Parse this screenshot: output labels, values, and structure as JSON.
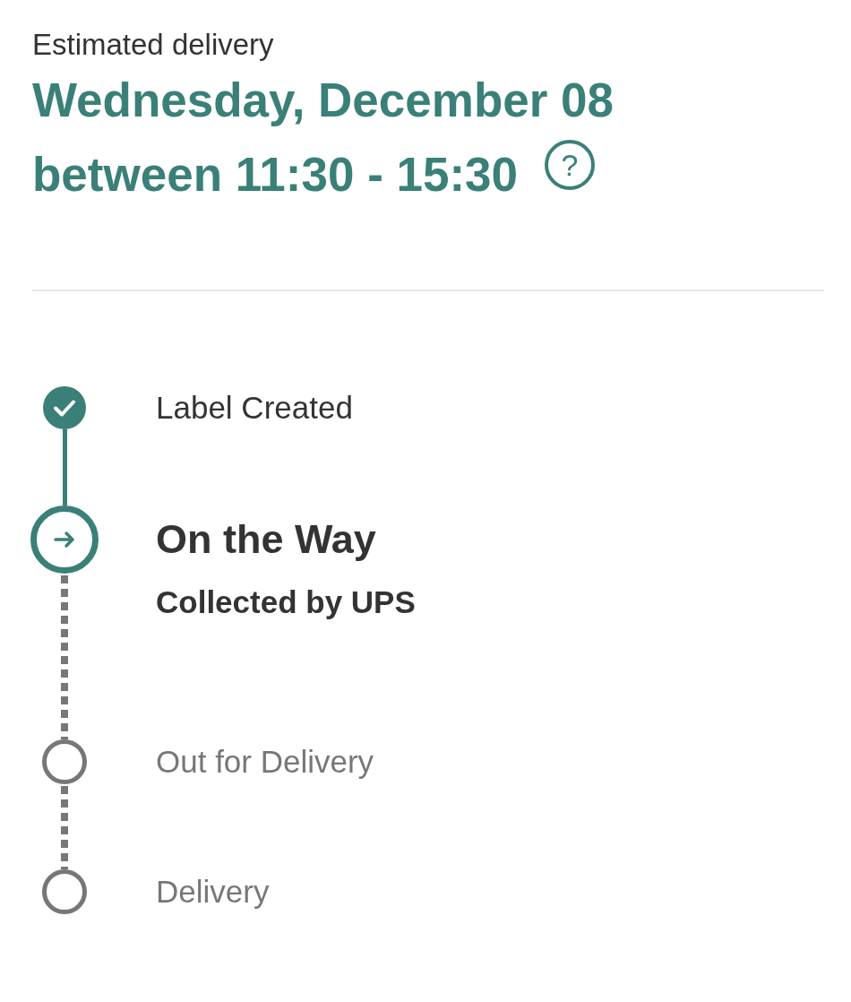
{
  "header": {
    "label": "Estimated delivery",
    "date": "Wednesday, December 08",
    "window": "between 11:30 - 15:30",
    "help_icon": "?"
  },
  "steps": [
    {
      "kind": "done",
      "title": "Label Created"
    },
    {
      "kind": "current",
      "title": "On the Way",
      "detail": "Collected by UPS"
    },
    {
      "kind": "pending",
      "title": "Out for Delivery"
    },
    {
      "kind": "pending",
      "title": "Delivery"
    }
  ]
}
